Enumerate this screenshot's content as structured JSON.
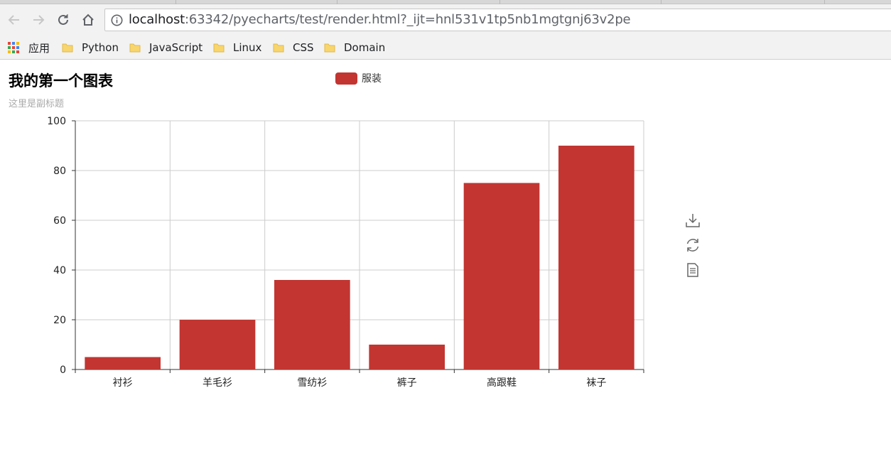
{
  "browser": {
    "url_host": "localhost",
    "url_rest": ":63342/pyecharts/test/render.html?_ijt=hnl531v1tp5nb1mgtgnj63v2pe"
  },
  "bookmarks": [
    {
      "label": "应用",
      "icon": "apps-grid-icon"
    },
    {
      "label": "Python",
      "icon": "folder-icon"
    },
    {
      "label": "JavaScript",
      "icon": "folder-icon"
    },
    {
      "label": "Linux",
      "icon": "folder-icon"
    },
    {
      "label": "CSS",
      "icon": "folder-icon"
    },
    {
      "label": "Domain",
      "icon": "folder-icon"
    }
  ],
  "colors": {
    "bar": "#c23531",
    "folder": "#f9d56e",
    "grid": "#cccccc"
  },
  "toolbox": [
    {
      "name": "save-as-image",
      "icon": "download-icon"
    },
    {
      "name": "restore",
      "icon": "refresh-icon"
    },
    {
      "name": "data-view",
      "icon": "document-icon"
    }
  ],
  "chart_data": {
    "type": "bar",
    "title": "我的第一个图表",
    "subtitle": "这里是副标题",
    "legend": [
      "服装"
    ],
    "legend_position": "top-center",
    "categories": [
      "衬衫",
      "羊毛衫",
      "雪纺衫",
      "裤子",
      "高跟鞋",
      "袜子"
    ],
    "series": [
      {
        "name": "服装",
        "values": [
          5,
          20,
          36,
          10,
          75,
          90
        ]
      }
    ],
    "ylim": [
      0,
      100
    ],
    "yticks": [
      0,
      20,
      40,
      60,
      80,
      100
    ],
    "grid": true,
    "xlabel": "",
    "ylabel": ""
  }
}
